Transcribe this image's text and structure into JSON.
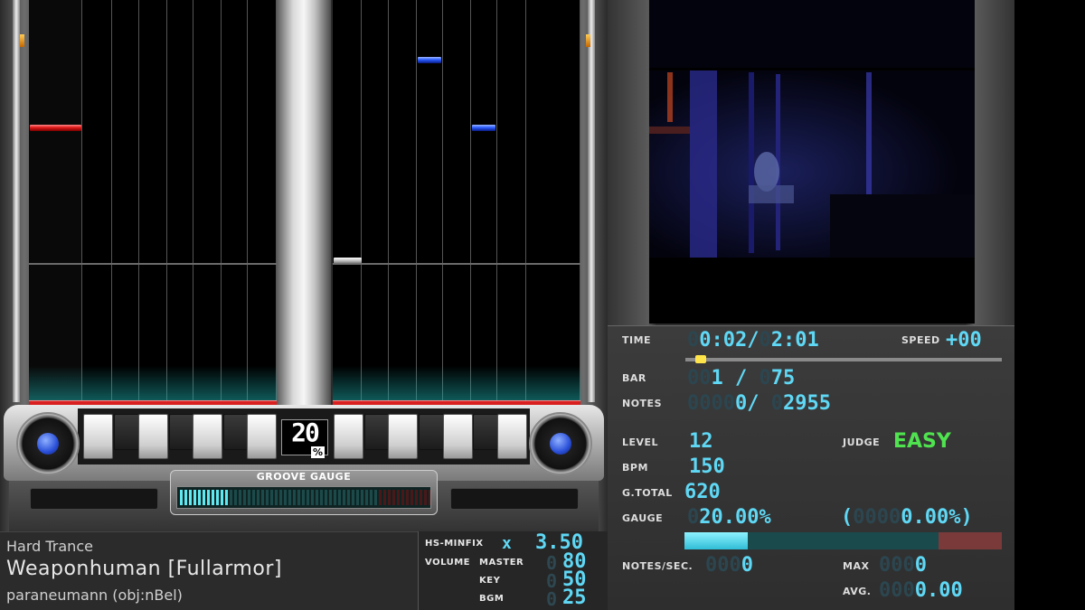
{
  "song": {
    "genre": "Hard Trance",
    "title": "Weaponhuman [Fullarmor]",
    "artist": "paraneumann (obj:nBel)"
  },
  "options": {
    "hs_label": "HS-MINFIX",
    "hs_x": "x",
    "hs_value": "3.50",
    "volume_label": "VOLUME",
    "master_label": "MASTER",
    "master_value": "80",
    "key_label": "KEY",
    "key_value": "50",
    "bgm_label": "BGM",
    "bgm_value": "25"
  },
  "deck": {
    "gauge_percent": "20",
    "percent_sign": "%",
    "groove_gauge_label": "GROOVE GAUGE",
    "groove_gauge_fraction": 0.2
  },
  "stats": {
    "time_label": "TIME",
    "time_current": "0:02",
    "time_total": "2:01",
    "speed_label": "SPEED",
    "speed_value": "+00",
    "time_progress_fraction": 0.03,
    "bar_label": "BAR",
    "bar_current": "1",
    "bar_total": "75",
    "notes_label": "NOTES",
    "notes_current": "0",
    "notes_total": "2955",
    "level_label": "LEVEL",
    "level_value": "12",
    "judge_label": "JUDGE",
    "judge_value": "EASY",
    "bpm_label": "BPM",
    "bpm_value": "150",
    "gtotal_label": "G.TOTAL",
    "gtotal_value": "620",
    "gauge_label": "GAUGE",
    "gauge_value": "20.00%",
    "gauge_best": "0.00%",
    "gauge_fraction": 0.2,
    "nps_label": "NOTES/SEC.",
    "nps_value": "0",
    "max_label": "MAX",
    "max_value": "0",
    "avg_label": "AVG.",
    "avg_value": "0.00"
  },
  "colors": {
    "accent_cyan": "#5fd8f5",
    "judge_easy": "#4fe34f",
    "note_red": "#e01818",
    "note_blue": "#2a5cff"
  }
}
